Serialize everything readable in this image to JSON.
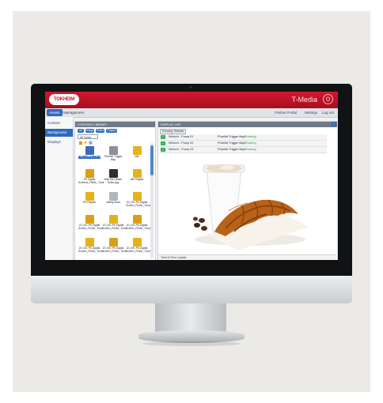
{
  "brand": {
    "logo_text": "TOKHEIM",
    "app_title": "T-Media",
    "accent": "#2c6bbf",
    "header_red": "#c4141e"
  },
  "nav": {
    "tabs": [
      "Assets",
      "Management"
    ],
    "right_links": [
      "Partner Portal",
      "Settings",
      "Log out"
    ]
  },
  "sidebar": {
    "items": [
      "Content",
      "Background",
      "Displays"
    ]
  },
  "library": {
    "title": "CONTENT LIBRARY",
    "filters": [
      "All",
      "Image",
      "Video",
      "Playlist"
    ],
    "folder_select": "All Types",
    "tiles": [
      {
        "caption": "Fuel_Coffee_PROMO.jpg",
        "color": "#3d6bb8",
        "selected": true
      },
      {
        "caption": "Pricelist Trigger Map",
        "color": "#8a8f98"
      },
      {
        "caption": "Idle",
        "color": "#e6b21a"
      },
      {
        "caption": "PK Digital Screens_FINAL_Tuna",
        "color": "#d9a017"
      },
      {
        "caption": "Well the Heater Notice.jpg",
        "color": "#2c2f36"
      },
      {
        "caption": "Idle Playlist",
        "color": "#e6b21a"
      },
      {
        "caption": "PK Playlist",
        "color": "#e6b21a"
      },
      {
        "caption": "Safety Audit",
        "color": "#b0b6bf"
      },
      {
        "caption": "20_001 PK Digital Screen_FINAL_Tuna",
        "color": "#e6b21a"
      },
      {
        "caption": "20_001 PK Digital Screen_FINAL_Tuna",
        "color": "#d9a017"
      },
      {
        "caption": "20_001 PK Digital Screen_FINAL_Tuna",
        "color": "#e6b21a"
      },
      {
        "caption": "20_001 PK Digital Screen_FINAL_Tuna",
        "color": "#d9a017"
      },
      {
        "caption": "20_001 PK Digital Screen_FINAL_Tuna",
        "color": "#e6b21a"
      },
      {
        "caption": "20_001 PK Digital Screen_FINAL_Tuna",
        "color": "#d9a017"
      },
      {
        "caption": "20_001 PK Digital Screen_FINAL_Tuna",
        "color": "#e6b21a"
      }
    ]
  },
  "playlist": {
    "title": "DISPLAY LIST",
    "badge": "+",
    "buttons": [
      "Preview",
      "Refresh"
    ],
    "rows": [
      {
        "name": "Wetoch - Pump 01",
        "type": "Pricelist Trigger Map",
        "status": "Showing"
      },
      {
        "name": "Wetoch - Pump 02",
        "type": "Pricelist Trigger Map",
        "status": "Showing"
      },
      {
        "name": "Wetoch - Pump 03",
        "type": "Pricelist Trigger Map",
        "status": "Showing"
      }
    ],
    "footer": "Time    At Time        Update"
  }
}
